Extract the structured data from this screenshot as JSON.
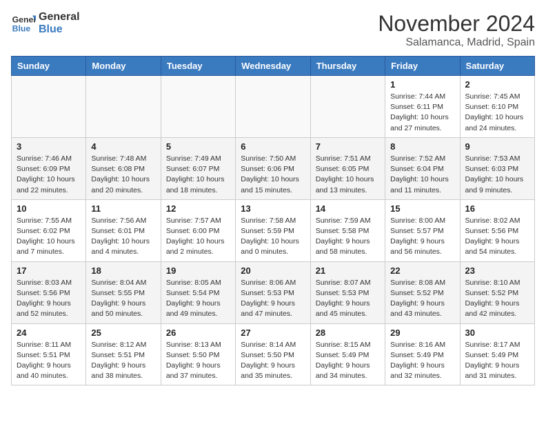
{
  "header": {
    "logo_line1": "General",
    "logo_line2": "Blue",
    "month_title": "November 2024",
    "location": "Salamanca, Madrid, Spain"
  },
  "weekdays": [
    "Sunday",
    "Monday",
    "Tuesday",
    "Wednesday",
    "Thursday",
    "Friday",
    "Saturday"
  ],
  "weeks": [
    [
      {
        "day": "",
        "info": ""
      },
      {
        "day": "",
        "info": ""
      },
      {
        "day": "",
        "info": ""
      },
      {
        "day": "",
        "info": ""
      },
      {
        "day": "",
        "info": ""
      },
      {
        "day": "1",
        "info": "Sunrise: 7:44 AM\nSunset: 6:11 PM\nDaylight: 10 hours and 27 minutes."
      },
      {
        "day": "2",
        "info": "Sunrise: 7:45 AM\nSunset: 6:10 PM\nDaylight: 10 hours and 24 minutes."
      }
    ],
    [
      {
        "day": "3",
        "info": "Sunrise: 7:46 AM\nSunset: 6:09 PM\nDaylight: 10 hours and 22 minutes."
      },
      {
        "day": "4",
        "info": "Sunrise: 7:48 AM\nSunset: 6:08 PM\nDaylight: 10 hours and 20 minutes."
      },
      {
        "day": "5",
        "info": "Sunrise: 7:49 AM\nSunset: 6:07 PM\nDaylight: 10 hours and 18 minutes."
      },
      {
        "day": "6",
        "info": "Sunrise: 7:50 AM\nSunset: 6:06 PM\nDaylight: 10 hours and 15 minutes."
      },
      {
        "day": "7",
        "info": "Sunrise: 7:51 AM\nSunset: 6:05 PM\nDaylight: 10 hours and 13 minutes."
      },
      {
        "day": "8",
        "info": "Sunrise: 7:52 AM\nSunset: 6:04 PM\nDaylight: 10 hours and 11 minutes."
      },
      {
        "day": "9",
        "info": "Sunrise: 7:53 AM\nSunset: 6:03 PM\nDaylight: 10 hours and 9 minutes."
      }
    ],
    [
      {
        "day": "10",
        "info": "Sunrise: 7:55 AM\nSunset: 6:02 PM\nDaylight: 10 hours and 7 minutes."
      },
      {
        "day": "11",
        "info": "Sunrise: 7:56 AM\nSunset: 6:01 PM\nDaylight: 10 hours and 4 minutes."
      },
      {
        "day": "12",
        "info": "Sunrise: 7:57 AM\nSunset: 6:00 PM\nDaylight: 10 hours and 2 minutes."
      },
      {
        "day": "13",
        "info": "Sunrise: 7:58 AM\nSunset: 5:59 PM\nDaylight: 10 hours and 0 minutes."
      },
      {
        "day": "14",
        "info": "Sunrise: 7:59 AM\nSunset: 5:58 PM\nDaylight: 9 hours and 58 minutes."
      },
      {
        "day": "15",
        "info": "Sunrise: 8:00 AM\nSunset: 5:57 PM\nDaylight: 9 hours and 56 minutes."
      },
      {
        "day": "16",
        "info": "Sunrise: 8:02 AM\nSunset: 5:56 PM\nDaylight: 9 hours and 54 minutes."
      }
    ],
    [
      {
        "day": "17",
        "info": "Sunrise: 8:03 AM\nSunset: 5:56 PM\nDaylight: 9 hours and 52 minutes."
      },
      {
        "day": "18",
        "info": "Sunrise: 8:04 AM\nSunset: 5:55 PM\nDaylight: 9 hours and 50 minutes."
      },
      {
        "day": "19",
        "info": "Sunrise: 8:05 AM\nSunset: 5:54 PM\nDaylight: 9 hours and 49 minutes."
      },
      {
        "day": "20",
        "info": "Sunrise: 8:06 AM\nSunset: 5:53 PM\nDaylight: 9 hours and 47 minutes."
      },
      {
        "day": "21",
        "info": "Sunrise: 8:07 AM\nSunset: 5:53 PM\nDaylight: 9 hours and 45 minutes."
      },
      {
        "day": "22",
        "info": "Sunrise: 8:08 AM\nSunset: 5:52 PM\nDaylight: 9 hours and 43 minutes."
      },
      {
        "day": "23",
        "info": "Sunrise: 8:10 AM\nSunset: 5:52 PM\nDaylight: 9 hours and 42 minutes."
      }
    ],
    [
      {
        "day": "24",
        "info": "Sunrise: 8:11 AM\nSunset: 5:51 PM\nDaylight: 9 hours and 40 minutes."
      },
      {
        "day": "25",
        "info": "Sunrise: 8:12 AM\nSunset: 5:51 PM\nDaylight: 9 hours and 38 minutes."
      },
      {
        "day": "26",
        "info": "Sunrise: 8:13 AM\nSunset: 5:50 PM\nDaylight: 9 hours and 37 minutes."
      },
      {
        "day": "27",
        "info": "Sunrise: 8:14 AM\nSunset: 5:50 PM\nDaylight: 9 hours and 35 minutes."
      },
      {
        "day": "28",
        "info": "Sunrise: 8:15 AM\nSunset: 5:49 PM\nDaylight: 9 hours and 34 minutes."
      },
      {
        "day": "29",
        "info": "Sunrise: 8:16 AM\nSunset: 5:49 PM\nDaylight: 9 hours and 32 minutes."
      },
      {
        "day": "30",
        "info": "Sunrise: 8:17 AM\nSunset: 5:49 PM\nDaylight: 9 hours and 31 minutes."
      }
    ]
  ]
}
